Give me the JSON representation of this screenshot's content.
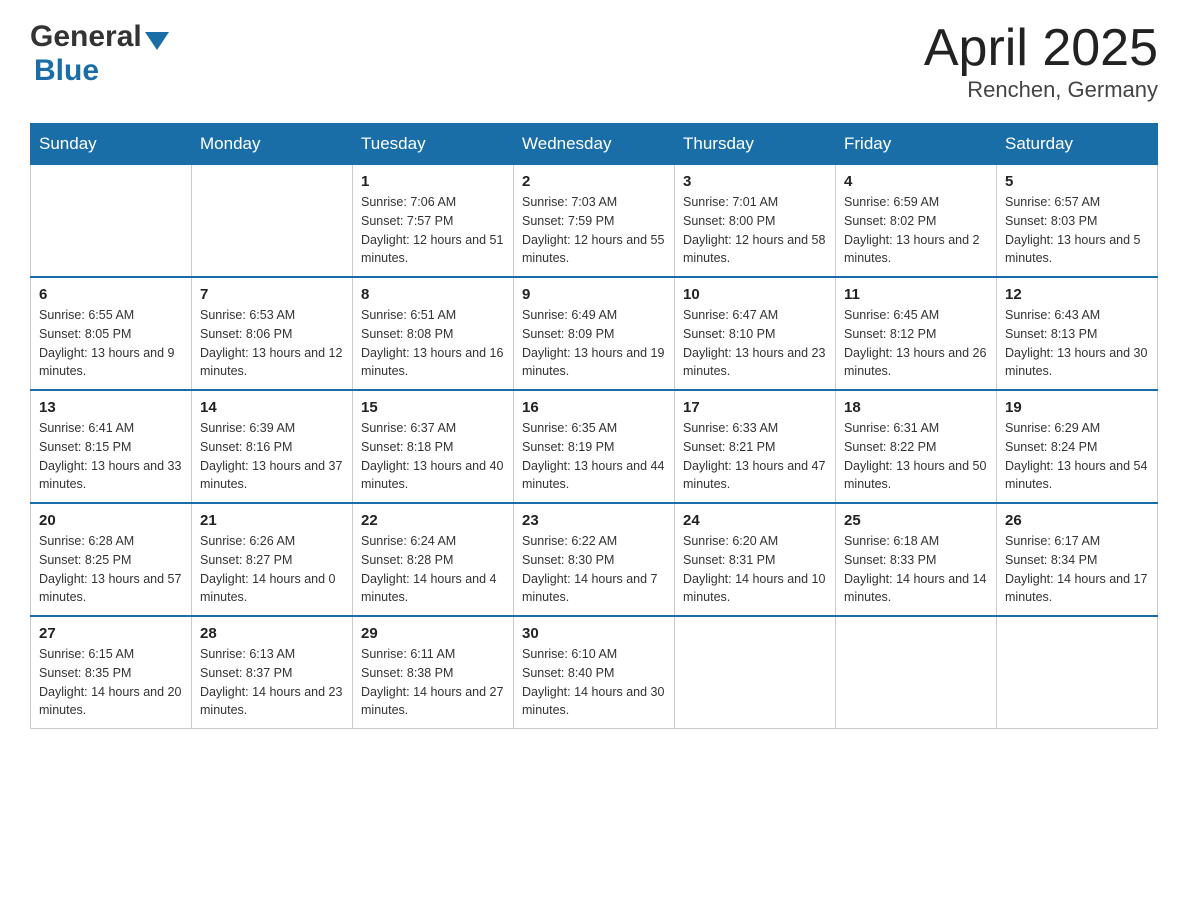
{
  "header": {
    "logo_general": "General",
    "logo_blue": "Blue",
    "month_title": "April 2025",
    "location": "Renchen, Germany"
  },
  "weekdays": [
    "Sunday",
    "Monday",
    "Tuesday",
    "Wednesday",
    "Thursday",
    "Friday",
    "Saturday"
  ],
  "weeks": [
    [
      {
        "day": "",
        "sunrise": "",
        "sunset": "",
        "daylight": ""
      },
      {
        "day": "",
        "sunrise": "",
        "sunset": "",
        "daylight": ""
      },
      {
        "day": "1",
        "sunrise": "Sunrise: 7:06 AM",
        "sunset": "Sunset: 7:57 PM",
        "daylight": "Daylight: 12 hours and 51 minutes."
      },
      {
        "day": "2",
        "sunrise": "Sunrise: 7:03 AM",
        "sunset": "Sunset: 7:59 PM",
        "daylight": "Daylight: 12 hours and 55 minutes."
      },
      {
        "day": "3",
        "sunrise": "Sunrise: 7:01 AM",
        "sunset": "Sunset: 8:00 PM",
        "daylight": "Daylight: 12 hours and 58 minutes."
      },
      {
        "day": "4",
        "sunrise": "Sunrise: 6:59 AM",
        "sunset": "Sunset: 8:02 PM",
        "daylight": "Daylight: 13 hours and 2 minutes."
      },
      {
        "day": "5",
        "sunrise": "Sunrise: 6:57 AM",
        "sunset": "Sunset: 8:03 PM",
        "daylight": "Daylight: 13 hours and 5 minutes."
      }
    ],
    [
      {
        "day": "6",
        "sunrise": "Sunrise: 6:55 AM",
        "sunset": "Sunset: 8:05 PM",
        "daylight": "Daylight: 13 hours and 9 minutes."
      },
      {
        "day": "7",
        "sunrise": "Sunrise: 6:53 AM",
        "sunset": "Sunset: 8:06 PM",
        "daylight": "Daylight: 13 hours and 12 minutes."
      },
      {
        "day": "8",
        "sunrise": "Sunrise: 6:51 AM",
        "sunset": "Sunset: 8:08 PM",
        "daylight": "Daylight: 13 hours and 16 minutes."
      },
      {
        "day": "9",
        "sunrise": "Sunrise: 6:49 AM",
        "sunset": "Sunset: 8:09 PM",
        "daylight": "Daylight: 13 hours and 19 minutes."
      },
      {
        "day": "10",
        "sunrise": "Sunrise: 6:47 AM",
        "sunset": "Sunset: 8:10 PM",
        "daylight": "Daylight: 13 hours and 23 minutes."
      },
      {
        "day": "11",
        "sunrise": "Sunrise: 6:45 AM",
        "sunset": "Sunset: 8:12 PM",
        "daylight": "Daylight: 13 hours and 26 minutes."
      },
      {
        "day": "12",
        "sunrise": "Sunrise: 6:43 AM",
        "sunset": "Sunset: 8:13 PM",
        "daylight": "Daylight: 13 hours and 30 minutes."
      }
    ],
    [
      {
        "day": "13",
        "sunrise": "Sunrise: 6:41 AM",
        "sunset": "Sunset: 8:15 PM",
        "daylight": "Daylight: 13 hours and 33 minutes."
      },
      {
        "day": "14",
        "sunrise": "Sunrise: 6:39 AM",
        "sunset": "Sunset: 8:16 PM",
        "daylight": "Daylight: 13 hours and 37 minutes."
      },
      {
        "day": "15",
        "sunrise": "Sunrise: 6:37 AM",
        "sunset": "Sunset: 8:18 PM",
        "daylight": "Daylight: 13 hours and 40 minutes."
      },
      {
        "day": "16",
        "sunrise": "Sunrise: 6:35 AM",
        "sunset": "Sunset: 8:19 PM",
        "daylight": "Daylight: 13 hours and 44 minutes."
      },
      {
        "day": "17",
        "sunrise": "Sunrise: 6:33 AM",
        "sunset": "Sunset: 8:21 PM",
        "daylight": "Daylight: 13 hours and 47 minutes."
      },
      {
        "day": "18",
        "sunrise": "Sunrise: 6:31 AM",
        "sunset": "Sunset: 8:22 PM",
        "daylight": "Daylight: 13 hours and 50 minutes."
      },
      {
        "day": "19",
        "sunrise": "Sunrise: 6:29 AM",
        "sunset": "Sunset: 8:24 PM",
        "daylight": "Daylight: 13 hours and 54 minutes."
      }
    ],
    [
      {
        "day": "20",
        "sunrise": "Sunrise: 6:28 AM",
        "sunset": "Sunset: 8:25 PM",
        "daylight": "Daylight: 13 hours and 57 minutes."
      },
      {
        "day": "21",
        "sunrise": "Sunrise: 6:26 AM",
        "sunset": "Sunset: 8:27 PM",
        "daylight": "Daylight: 14 hours and 0 minutes."
      },
      {
        "day": "22",
        "sunrise": "Sunrise: 6:24 AM",
        "sunset": "Sunset: 8:28 PM",
        "daylight": "Daylight: 14 hours and 4 minutes."
      },
      {
        "day": "23",
        "sunrise": "Sunrise: 6:22 AM",
        "sunset": "Sunset: 8:30 PM",
        "daylight": "Daylight: 14 hours and 7 minutes."
      },
      {
        "day": "24",
        "sunrise": "Sunrise: 6:20 AM",
        "sunset": "Sunset: 8:31 PM",
        "daylight": "Daylight: 14 hours and 10 minutes."
      },
      {
        "day": "25",
        "sunrise": "Sunrise: 6:18 AM",
        "sunset": "Sunset: 8:33 PM",
        "daylight": "Daylight: 14 hours and 14 minutes."
      },
      {
        "day": "26",
        "sunrise": "Sunrise: 6:17 AM",
        "sunset": "Sunset: 8:34 PM",
        "daylight": "Daylight: 14 hours and 17 minutes."
      }
    ],
    [
      {
        "day": "27",
        "sunrise": "Sunrise: 6:15 AM",
        "sunset": "Sunset: 8:35 PM",
        "daylight": "Daylight: 14 hours and 20 minutes."
      },
      {
        "day": "28",
        "sunrise": "Sunrise: 6:13 AM",
        "sunset": "Sunset: 8:37 PM",
        "daylight": "Daylight: 14 hours and 23 minutes."
      },
      {
        "day": "29",
        "sunrise": "Sunrise: 6:11 AM",
        "sunset": "Sunset: 8:38 PM",
        "daylight": "Daylight: 14 hours and 27 minutes."
      },
      {
        "day": "30",
        "sunrise": "Sunrise: 6:10 AM",
        "sunset": "Sunset: 8:40 PM",
        "daylight": "Daylight: 14 hours and 30 minutes."
      },
      {
        "day": "",
        "sunrise": "",
        "sunset": "",
        "daylight": ""
      },
      {
        "day": "",
        "sunrise": "",
        "sunset": "",
        "daylight": ""
      },
      {
        "day": "",
        "sunrise": "",
        "sunset": "",
        "daylight": ""
      }
    ]
  ]
}
